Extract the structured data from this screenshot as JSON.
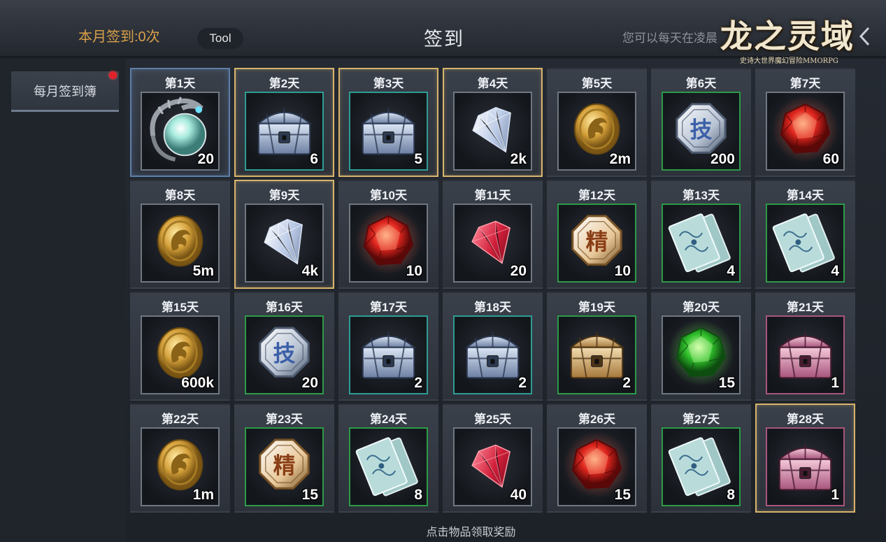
{
  "header": {
    "monthly_count": "本月签到:0次",
    "tool_label": "Tool",
    "title": "签到",
    "marquee": "您可以每天在凌晨",
    "close_icon": "chevron-left-icon"
  },
  "logo": {
    "title": "龙之灵域",
    "subtitle": "史诗大世界魔幻冒险MMORPG"
  },
  "sidebar": {
    "tab_label": "每月签到簿",
    "has_notification": true
  },
  "colors": {
    "accent_gold": "#d8b46c",
    "count_orange": "#d8a04a",
    "quality_teal": "#2f9c93",
    "quality_green": "#2e9a48",
    "quality_pink": "#a8557d",
    "notify_red": "#e2222a"
  },
  "rewards": [
    {
      "day": "第1天",
      "item": "dragon-orb",
      "qty": "20",
      "quality": "gray",
      "highlight": "blue"
    },
    {
      "day": "第2天",
      "item": "silver-chest",
      "qty": "6",
      "quality": "teal",
      "highlight": "gold"
    },
    {
      "day": "第3天",
      "item": "silver-chest",
      "qty": "5",
      "quality": "teal",
      "highlight": "gold"
    },
    {
      "day": "第4天",
      "item": "diamond",
      "qty": "2k",
      "quality": "gray",
      "highlight": "gold"
    },
    {
      "day": "第5天",
      "item": "gold-coin",
      "qty": "2m",
      "quality": "gray",
      "highlight": ""
    },
    {
      "day": "第6天",
      "item": "skill-token",
      "qty": "200",
      "quality": "green",
      "highlight": ""
    },
    {
      "day": "第7天",
      "item": "red-gem",
      "qty": "60",
      "quality": "gray",
      "highlight": ""
    },
    {
      "day": "第8天",
      "item": "gold-coin",
      "qty": "5m",
      "quality": "gray",
      "highlight": ""
    },
    {
      "day": "第9天",
      "item": "diamond",
      "qty": "4k",
      "quality": "gray",
      "highlight": "gold"
    },
    {
      "day": "第10天",
      "item": "red-gem",
      "qty": "10",
      "quality": "gray",
      "highlight": ""
    },
    {
      "day": "第11天",
      "item": "ruby",
      "qty": "20",
      "quality": "gray",
      "highlight": ""
    },
    {
      "day": "第12天",
      "item": "essence-token",
      "qty": "10",
      "quality": "green",
      "highlight": ""
    },
    {
      "day": "第13天",
      "item": "ticket",
      "qty": "4",
      "quality": "green",
      "highlight": ""
    },
    {
      "day": "第14天",
      "item": "ticket",
      "qty": "4",
      "quality": "green",
      "highlight": ""
    },
    {
      "day": "第15天",
      "item": "gold-coin",
      "qty": "600k",
      "quality": "gray",
      "highlight": ""
    },
    {
      "day": "第16天",
      "item": "skill-token",
      "qty": "20",
      "quality": "green",
      "highlight": ""
    },
    {
      "day": "第17天",
      "item": "silver-chest",
      "qty": "2",
      "quality": "teal",
      "highlight": ""
    },
    {
      "day": "第18天",
      "item": "silver-chest",
      "qty": "2",
      "quality": "teal",
      "highlight": ""
    },
    {
      "day": "第19天",
      "item": "gold-chest",
      "qty": "2",
      "quality": "green",
      "highlight": ""
    },
    {
      "day": "第20天",
      "item": "green-gem",
      "qty": "15",
      "quality": "gray",
      "highlight": ""
    },
    {
      "day": "第21天",
      "item": "pink-chest",
      "qty": "1",
      "quality": "pink",
      "highlight": ""
    },
    {
      "day": "第22天",
      "item": "gold-coin",
      "qty": "1m",
      "quality": "gray",
      "highlight": ""
    },
    {
      "day": "第23天",
      "item": "essence-token",
      "qty": "15",
      "quality": "green",
      "highlight": ""
    },
    {
      "day": "第24天",
      "item": "ticket",
      "qty": "8",
      "quality": "green",
      "highlight": ""
    },
    {
      "day": "第25天",
      "item": "ruby",
      "qty": "40",
      "quality": "gray",
      "highlight": ""
    },
    {
      "day": "第26天",
      "item": "red-gem",
      "qty": "15",
      "quality": "gray",
      "highlight": ""
    },
    {
      "day": "第27天",
      "item": "ticket",
      "qty": "8",
      "quality": "green",
      "highlight": ""
    },
    {
      "day": "第28天",
      "item": "pink-chest",
      "qty": "1",
      "quality": "pink",
      "highlight": "gold"
    }
  ],
  "icon_text": {
    "skill": "技",
    "essence": "精"
  },
  "footer": {
    "hint": "点击物品领取奖励"
  }
}
